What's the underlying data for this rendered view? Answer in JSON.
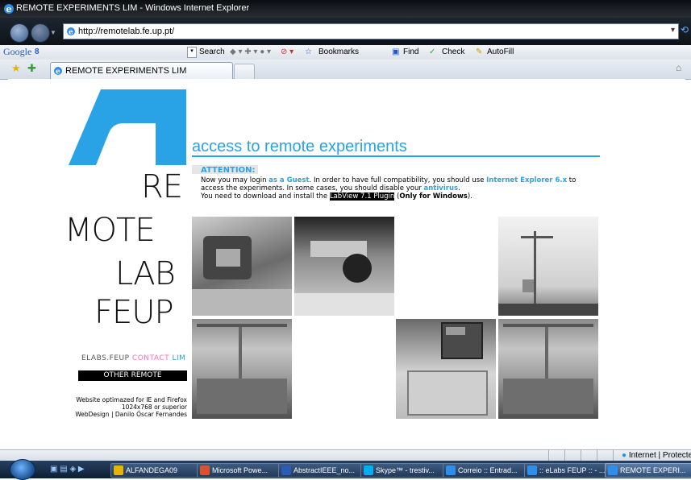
{
  "window": {
    "title": "REMOTE EXPERIMENTS LIM - Windows Internet Explorer"
  },
  "address_bar": {
    "url": "http://remotelab.fe.up.pt/"
  },
  "google_toolbar": {
    "logo": "Google",
    "items": [
      "8",
      "Search",
      "Bookmarks",
      "Find",
      "Check",
      "AutoFill"
    ]
  },
  "tabs": [
    {
      "label": "REMOTE EXPERIMENTS LIM"
    }
  ],
  "page": {
    "heading": "access to remote experiments",
    "attention": "ATTENTION:",
    "line1_a": "Now you may login ",
    "line1_guest": "as a Guest",
    "line1_b": ". In order to have full compatibility, you should use ",
    "line1_ie": "Internet Explorer 6.x",
    "line1_c": " to",
    "line2_a": "access the experiments. In some cases, you should disable your ",
    "line2_av": "antivirus",
    "line2_b": ".",
    "line3_a": "You need to download and install the ",
    "line3_plugin": "LabView 7.1 Plugin",
    "line3_b": " (",
    "line3_win": "Only for Windows",
    "line3_c": ").",
    "logo_lines": [
      "RE",
      "MOTE",
      "LAB",
      "FEUP"
    ],
    "links": {
      "elabs": "ELABS.FEUP",
      "contact": "CONTACT",
      "lim": "LIM"
    },
    "other_experiments": "OTHER REMOTE EXPERIMENTS",
    "footer": [
      "Website optimazed for IE and Firefox",
      "1024x768 or superior",
      "WebDesign | Danilo Óscar Fernandes"
    ]
  },
  "status_bar": {
    "zone": "Internet | Protecte"
  },
  "taskbar": {
    "items": [
      "ALFANDEGA09",
      "Microsoft Powe...",
      "AbstractIEEE_no...",
      "Skype™ - trestiv...",
      "Correio :: Entrad...",
      ":: eLabs FEUP :: - ...",
      "REMOTE EXPERI..."
    ]
  },
  "colors": {
    "accent": "#29a3e6",
    "contact": "#ff6eb4"
  }
}
